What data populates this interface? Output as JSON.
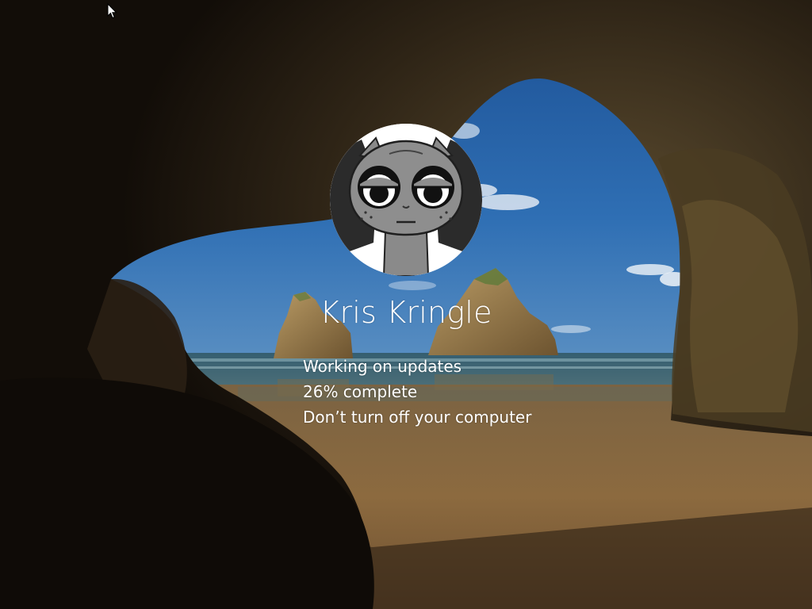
{
  "user": {
    "name": "Kris Kringle",
    "avatar_icon": "cartoon-character-avatar-icon"
  },
  "update_status": {
    "line1": "Working on updates",
    "line2": "26% complete",
    "line3": "Don’t turn off your computer",
    "progress_percent": 26
  },
  "colors": {
    "text": "#ffffff",
    "sky": "#2f6bb0",
    "sea": "#3a6478",
    "sand": "#8a6a3c",
    "cave": "#1a130c"
  },
  "cursor_icon": "mouse-pointer-icon"
}
